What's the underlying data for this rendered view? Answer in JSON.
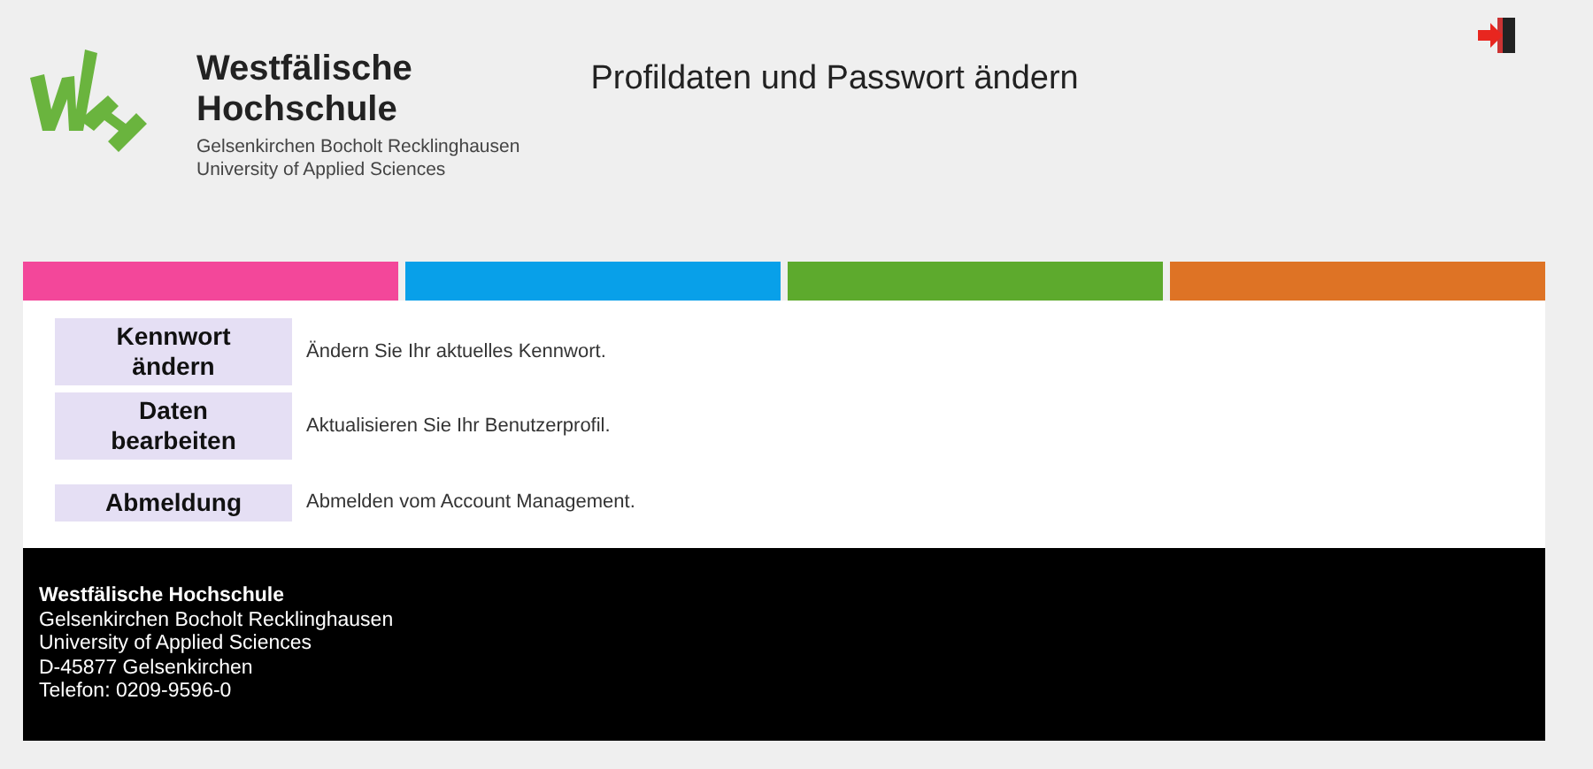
{
  "logo": {
    "name_lines": [
      "Westfälische",
      "Hochschule"
    ],
    "sub_lines": [
      "Gelsenkirchen Bocholt Recklinghausen",
      "University of Applied Sciences"
    ]
  },
  "page_title": "Profildaten und Passwort ändern",
  "stripes": [
    {
      "color": "#f3479a"
    },
    {
      "color": "#08a0e9"
    },
    {
      "color": "#5daa2d"
    },
    {
      "color": "#de7325"
    }
  ],
  "actions": [
    {
      "label_lines": [
        "Kennwort",
        "ändern"
      ],
      "description": "Ändern Sie Ihr aktuelles Kennwort."
    },
    {
      "label_lines": [
        "Daten",
        "bearbeiten"
      ],
      "description": "Aktualisieren Sie Ihr Benutzerprofil."
    },
    {
      "label_lines": [
        "Abmeldung"
      ],
      "description": "Abmelden vom Account Management."
    }
  ],
  "footer": {
    "title": "Westfälische Hochschule",
    "lines": [
      "Gelsenkirchen Bocholt Recklinghausen",
      "University of Applied Sciences",
      "D-45877 Gelsenkirchen",
      "Telefon: 0209-9596-0"
    ]
  }
}
